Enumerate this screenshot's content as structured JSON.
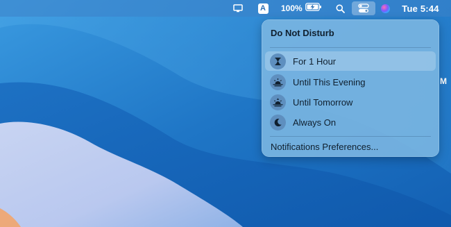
{
  "menubar": {
    "display_icon": "display-icon",
    "input_source": "A",
    "battery_percent": "100%",
    "battery_icon": "battery-charging-icon",
    "search_icon": "search-icon",
    "control_center_icon": "control-center-icon",
    "siri_icon": "siri-icon",
    "clock": "Tue 5:44"
  },
  "dnd_menu": {
    "title": "Do Not Disturb",
    "items": [
      {
        "label": "For 1 Hour",
        "icon": "hourglass-icon",
        "highlighted": true
      },
      {
        "label": "Until This Evening",
        "icon": "sunset-icon",
        "highlighted": false
      },
      {
        "label": "Until Tomorrow",
        "icon": "sunrise-icon",
        "highlighted": false
      },
      {
        "label": "Always On",
        "icon": "moon-icon",
        "highlighted": false
      }
    ],
    "preferences_label": "Notifications Preferences..."
  },
  "desktop": {
    "edge_text": "M"
  },
  "colors": {
    "wallpaper_blue": "#1b6fc0",
    "panel_background": "#78b4e1",
    "icon_circle": "#5e8fbf"
  }
}
